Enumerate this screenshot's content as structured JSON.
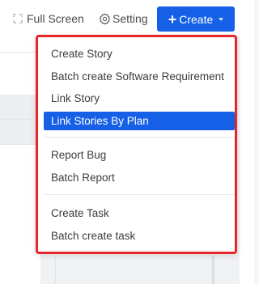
{
  "toolbar": {
    "fullscreen_label": "Full Screen",
    "setting_label": "Setting",
    "create_label": "Create"
  },
  "colors": {
    "accent": "#1560e6",
    "highlight_border": "#e8262a"
  },
  "icons": {
    "fullscreen": "fullscreen-icon",
    "setting": "gear-icon",
    "create": "plus-icon",
    "dropdown": "chevron-down-icon"
  },
  "menu": {
    "groups": [
      {
        "items": [
          {
            "label": "Create Story"
          },
          {
            "label": "Batch create Software Requirement"
          },
          {
            "label": "Link Story"
          },
          {
            "label": "Link Stories By Plan",
            "selected": true
          }
        ]
      },
      {
        "items": [
          {
            "label": "Report Bug"
          },
          {
            "label": "Batch Report"
          }
        ]
      },
      {
        "items": [
          {
            "label": "Create Task"
          },
          {
            "label": "Batch create task"
          }
        ]
      }
    ]
  }
}
